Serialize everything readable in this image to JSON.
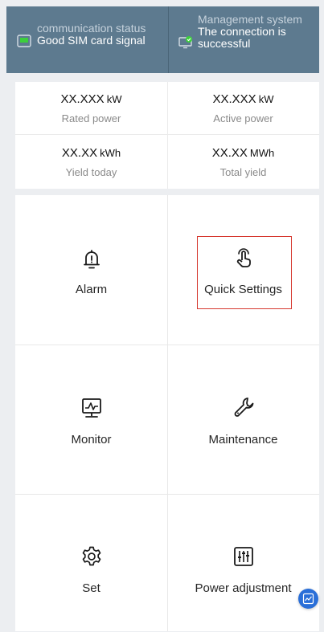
{
  "header": {
    "communication": {
      "title": "communication status",
      "value": "Good SIM card signal",
      "icon": "sim-card-icon"
    },
    "management": {
      "title": "Management system",
      "value": "The connection is successful",
      "icon": "monitor-check-icon"
    }
  },
  "metrics": [
    {
      "value": "XX.XXX",
      "unit": "kW",
      "label": "Rated power"
    },
    {
      "value": "XX.XXX",
      "unit": "kW",
      "label": "Active power"
    },
    {
      "value": "XX.XX",
      "unit": "kWh",
      "label": "Yield today"
    },
    {
      "value": "XX.XX",
      "unit": "MWh",
      "label": "Total yield"
    }
  ],
  "tiles": [
    {
      "label": "Alarm",
      "icon": "bell-alert-icon"
    },
    {
      "label": "Quick Settings",
      "icon": "tap-hand-icon"
    },
    {
      "label": "Monitor",
      "icon": "monitor-icon"
    },
    {
      "label": "Maintenance",
      "icon": "wrench-icon"
    },
    {
      "label": "Set",
      "icon": "gear-icon"
    },
    {
      "label": "Power adjustment",
      "icon": "sliders-icon"
    }
  ],
  "colors": {
    "header_bg": "#5d7a8f",
    "accent": "#2a6fd8",
    "highlight": "#d6382f",
    "icon": "#1a1a1a",
    "status_ok": "#3ccf3c"
  },
  "floating_button": {
    "icon": "trend-chart-icon"
  }
}
